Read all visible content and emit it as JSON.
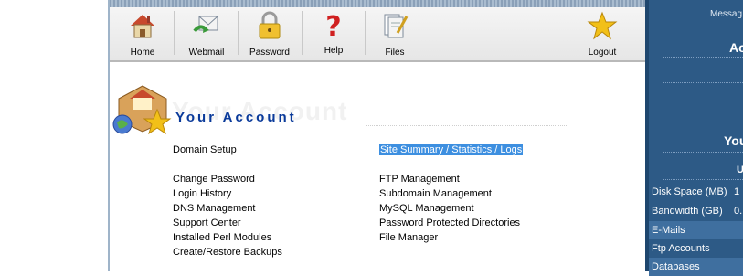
{
  "toolbar": {
    "items": [
      {
        "label": "Home",
        "icon": "home-icon"
      },
      {
        "label": "Webmail",
        "icon": "webmail-icon"
      },
      {
        "label": "Password",
        "icon": "lock-icon"
      },
      {
        "label": "Help",
        "icon": "question-icon"
      },
      {
        "label": "Files",
        "icon": "files-icon"
      },
      {
        "label": "Logout",
        "icon": "star-icon"
      }
    ]
  },
  "account": {
    "watermark": "Your Account",
    "title": "Your Account"
  },
  "links": {
    "left": [
      "Domain Setup",
      "Change Password",
      "Login History",
      "DNS Management",
      "Support Center",
      "Installed Perl Modules",
      "Create/Restore Backups"
    ],
    "right": [
      "Site Summary / Statistics / Logs",
      "FTP Management",
      "Subdomain Management",
      "MySQL Management",
      "Password Protected Directories",
      "File Manager"
    ]
  },
  "right_panel": {
    "message_label": "Messag",
    "heading_a": "Ac",
    "heading_you": "You",
    "heading_u": "U",
    "rows": [
      {
        "label": "Disk Space (MB)",
        "value": "1"
      },
      {
        "label": "Bandwidth (GB)",
        "value": "0."
      },
      {
        "label": "E-Mails",
        "value": ""
      },
      {
        "label": "Ftp Accounts",
        "value": ""
      },
      {
        "label": "Databases",
        "value": ""
      }
    ]
  },
  "colors": {
    "panel": "#2d5a86",
    "title": "#0a3a9a",
    "selection": "#3d8fe0"
  }
}
